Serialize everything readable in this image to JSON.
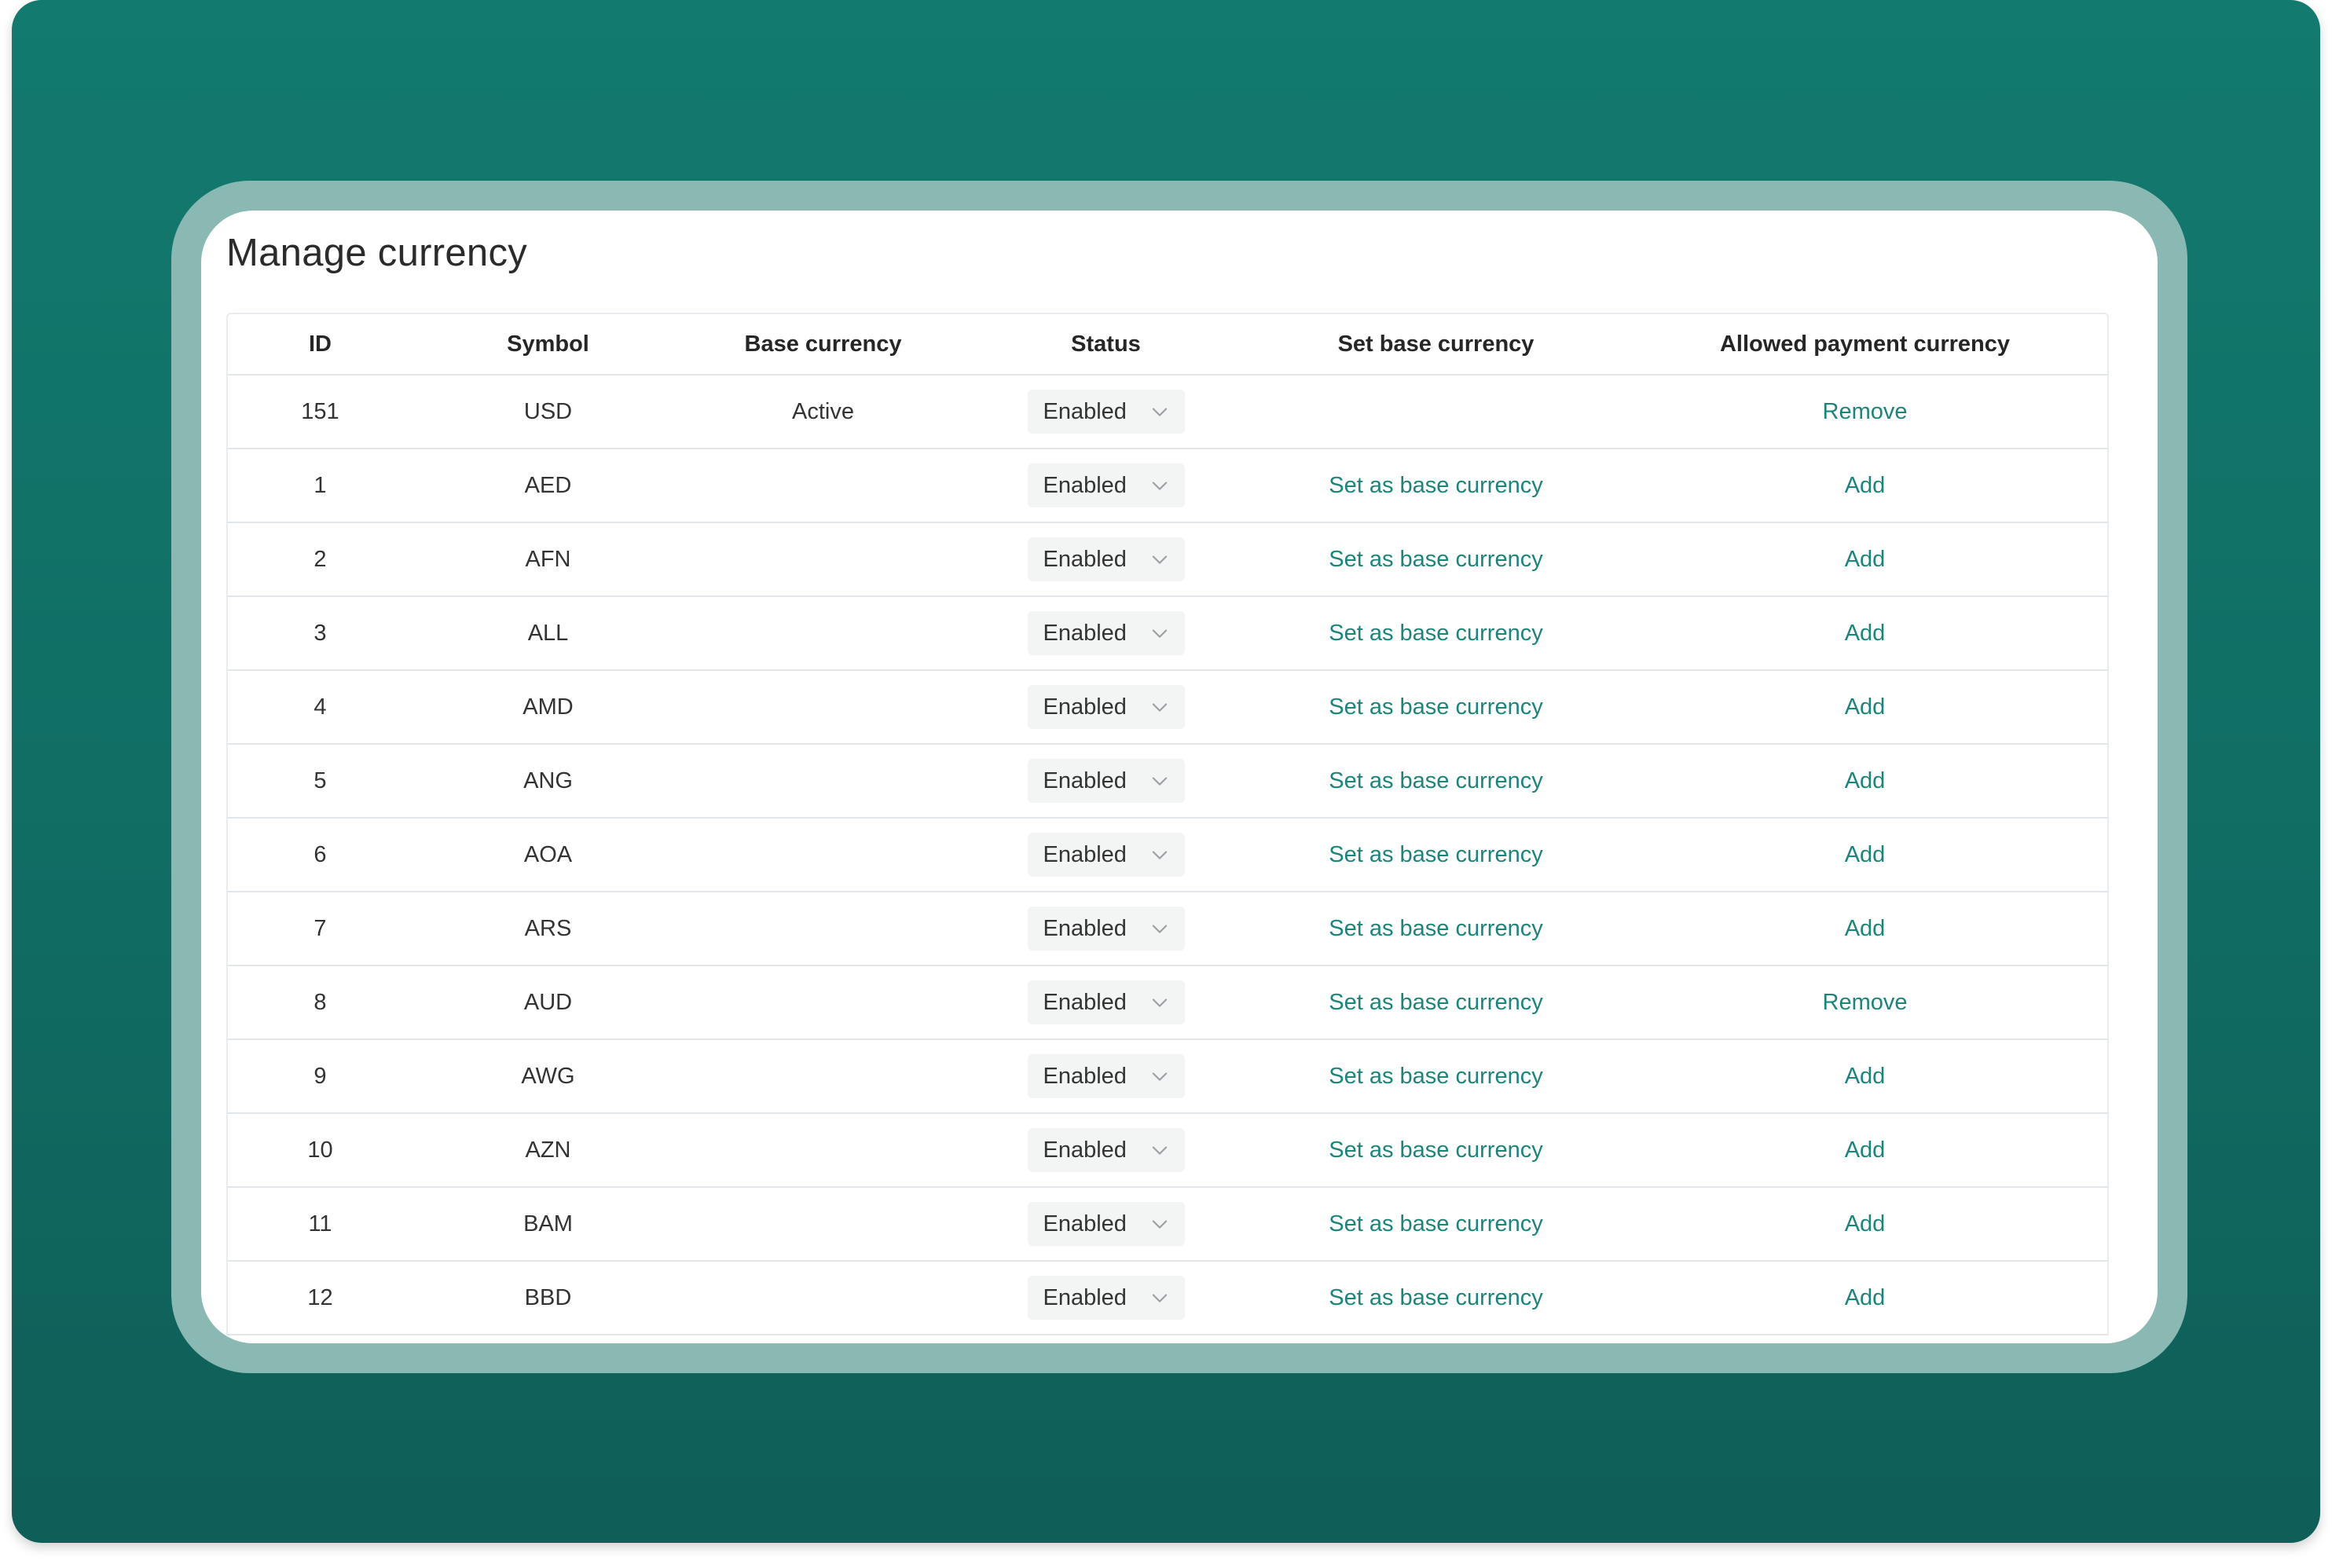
{
  "page": {
    "title": "Manage currency"
  },
  "table": {
    "columns": [
      "ID",
      "Symbol",
      "Base currency",
      "Status",
      "Set base currency",
      "Allowed payment currency"
    ],
    "rows": [
      {
        "id": "151",
        "symbol": "USD",
        "base": "Active",
        "status": "Enabled",
        "set_base": "",
        "allowed": "Remove"
      },
      {
        "id": "1",
        "symbol": "AED",
        "base": "",
        "status": "Enabled",
        "set_base": "Set as base currency",
        "allowed": "Add"
      },
      {
        "id": "2",
        "symbol": "AFN",
        "base": "",
        "status": "Enabled",
        "set_base": "Set as base currency",
        "allowed": "Add"
      },
      {
        "id": "3",
        "symbol": "ALL",
        "base": "",
        "status": "Enabled",
        "set_base": "Set as base currency",
        "allowed": "Add"
      },
      {
        "id": "4",
        "symbol": "AMD",
        "base": "",
        "status": "Enabled",
        "set_base": "Set as base currency",
        "allowed": "Add"
      },
      {
        "id": "5",
        "symbol": "ANG",
        "base": "",
        "status": "Enabled",
        "set_base": "Set as base currency",
        "allowed": "Add"
      },
      {
        "id": "6",
        "symbol": "AOA",
        "base": "",
        "status": "Enabled",
        "set_base": "Set as base currency",
        "allowed": "Add"
      },
      {
        "id": "7",
        "symbol": "ARS",
        "base": "",
        "status": "Enabled",
        "set_base": "Set as base currency",
        "allowed": "Add"
      },
      {
        "id": "8",
        "symbol": "AUD",
        "base": "",
        "status": "Enabled",
        "set_base": "Set as base currency",
        "allowed": "Remove"
      },
      {
        "id": "9",
        "symbol": "AWG",
        "base": "",
        "status": "Enabled",
        "set_base": "Set as base currency",
        "allowed": "Add"
      },
      {
        "id": "10",
        "symbol": "AZN",
        "base": "",
        "status": "Enabled",
        "set_base": "Set as base currency",
        "allowed": "Add"
      },
      {
        "id": "11",
        "symbol": "BAM",
        "base": "",
        "status": "Enabled",
        "set_base": "Set as base currency",
        "allowed": "Add"
      },
      {
        "id": "12",
        "symbol": "BBD",
        "base": "",
        "status": "Enabled",
        "set_base": "Set as base currency",
        "allowed": "Add"
      }
    ]
  },
  "icons": {
    "status_dropdown": "chevron-down-icon"
  },
  "colors": {
    "background_top": "#127a6f",
    "background_bottom": "#0f5e57",
    "frame": "#8ab9b3",
    "link": "#1b857a"
  }
}
